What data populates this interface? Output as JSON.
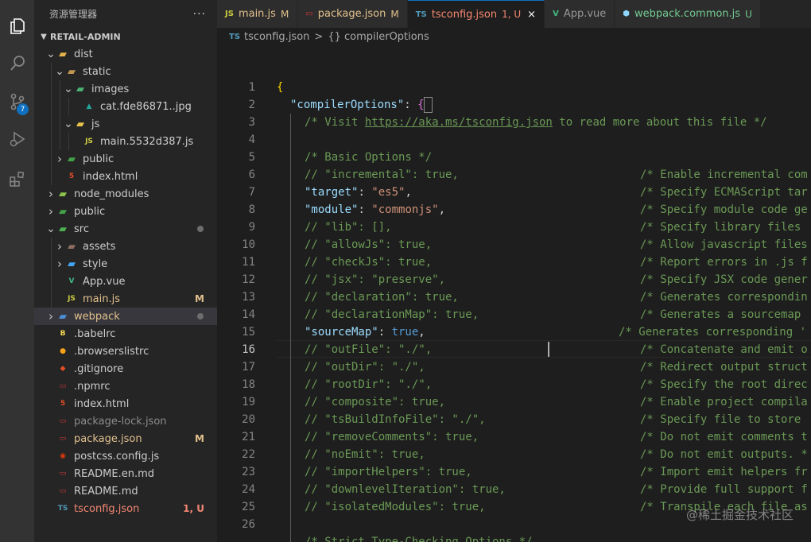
{
  "activity_bar": {
    "icons": [
      "explorer-icon",
      "search-icon",
      "source-control-icon",
      "run-debug-icon",
      "extensions-icon"
    ],
    "scm_badge": "7"
  },
  "sidebar": {
    "title": "资源管理器",
    "more": "···",
    "section": "RETAIL-ADMIN",
    "tree": [
      {
        "label": "dist",
        "type": "folder",
        "open": true,
        "depth": 0,
        "icon": "dist-folder-icon"
      },
      {
        "label": "static",
        "type": "folder",
        "open": true,
        "depth": 1,
        "icon": "folder-icon"
      },
      {
        "label": "images",
        "type": "folder",
        "open": true,
        "depth": 2,
        "icon": "images-folder-icon"
      },
      {
        "label": "cat.fde86871..jpg",
        "type": "file",
        "depth": 3,
        "icon": "image-file-icon"
      },
      {
        "label": "js",
        "type": "folder",
        "open": true,
        "depth": 2,
        "icon": "js-folder-icon"
      },
      {
        "label": "main.5532d387.js",
        "type": "file",
        "depth": 3,
        "icon": "js-file-icon"
      },
      {
        "label": "public",
        "type": "folder",
        "open": false,
        "depth": 1,
        "icon": "public-folder-icon"
      },
      {
        "label": "index.html",
        "type": "file",
        "depth": 1,
        "icon": "html-file-icon"
      },
      {
        "label": "node_modules",
        "type": "folder",
        "open": false,
        "depth": 0,
        "icon": "node-folder-icon"
      },
      {
        "label": "public",
        "type": "folder",
        "open": false,
        "depth": 0,
        "icon": "public-folder-icon"
      },
      {
        "label": "src",
        "type": "folder",
        "open": true,
        "depth": 0,
        "icon": "src-folder-icon",
        "dot": true
      },
      {
        "label": "assets",
        "type": "folder",
        "open": false,
        "depth": 1,
        "icon": "assets-folder-icon"
      },
      {
        "label": "style",
        "type": "folder",
        "open": false,
        "depth": 1,
        "icon": "style-folder-icon"
      },
      {
        "label": "App.vue",
        "type": "file",
        "depth": 1,
        "icon": "vue-file-icon"
      },
      {
        "label": "main.js",
        "type": "file",
        "depth": 1,
        "icon": "js-file-icon",
        "status": "M",
        "modified": true
      },
      {
        "label": "webpack",
        "type": "folder",
        "open": false,
        "depth": 0,
        "icon": "webpack-folder-icon",
        "dot": true,
        "selected": true
      },
      {
        "label": ".babelrc",
        "type": "file",
        "depth": 0,
        "icon": "babel-file-icon"
      },
      {
        "label": ".browserslistrc",
        "type": "file",
        "depth": 0,
        "icon": "browserslist-file-icon"
      },
      {
        "label": ".gitignore",
        "type": "file",
        "depth": 0,
        "icon": "git-file-icon"
      },
      {
        "label": ".npmrc",
        "type": "file",
        "depth": 0,
        "icon": "npm-file-icon"
      },
      {
        "label": "index.html",
        "type": "file",
        "depth": 0,
        "icon": "html-file-icon"
      },
      {
        "label": "package-lock.json",
        "type": "file",
        "depth": 0,
        "icon": "npm-file-icon",
        "ignored": true
      },
      {
        "label": "package.json",
        "type": "file",
        "depth": 0,
        "icon": "npm-file-icon",
        "status": "M",
        "modified": true
      },
      {
        "label": "postcss.config.js",
        "type": "file",
        "depth": 0,
        "icon": "postcss-file-icon"
      },
      {
        "label": "README.en.md",
        "type": "file",
        "depth": 0,
        "icon": "markdown-file-icon"
      },
      {
        "label": "README.md",
        "type": "file",
        "depth": 0,
        "icon": "markdown-file-icon"
      },
      {
        "label": "tsconfig.json",
        "type": "file",
        "depth": 0,
        "icon": "ts-file-icon",
        "status": "1, U",
        "error": true
      }
    ]
  },
  "tabs": [
    {
      "label": "main.js",
      "icon_text": "JS",
      "icon": "js-file-icon",
      "status": "M",
      "kind": "modified"
    },
    {
      "label": "package.json",
      "icon_text": "▭",
      "icon": "npm-file-icon",
      "status": "M",
      "kind": "modified"
    },
    {
      "label": "tsconfig.json",
      "icon_text": "TS",
      "icon": "ts-file-icon",
      "status": "1, U",
      "kind": "error",
      "active": true,
      "close": "×"
    },
    {
      "label": "App.vue",
      "icon_text": "V",
      "icon": "vue-file-icon",
      "status": "",
      "kind": ""
    },
    {
      "label": "webpack.common.js",
      "icon_text": "⬢",
      "icon": "webpack-file-icon",
      "status": "U",
      "kind": "untracked"
    }
  ],
  "breadcrumb": {
    "file": "tsconfig.json",
    "file_icon": "TS",
    "separator": ">",
    "symbol": "{} compilerOptions"
  },
  "code": {
    "first_line": 1,
    "current_line": 16,
    "lines": [
      {
        "n": "1",
        "html": "<span class='brace'>{</span>",
        "indent": 0
      },
      {
        "n": "2",
        "html": "<span class='key'>\"compilerOptions\"</span>: <span class='brace2'>{</span>",
        "indent": 1
      },
      {
        "n": "3",
        "html": "<span class='c'>/* Visit </span><span class='link'>https://aka.ms/tsconfig.json</span><span class='c'> to read more about this file */</span>",
        "indent": 2
      },
      {
        "n": "4",
        "html": "",
        "indent": 0
      },
      {
        "n": "5",
        "html": "<span class='c'>/* Basic Options */</span>",
        "indent": 2
      },
      {
        "n": "6",
        "html": "<span class='c'>// \"incremental\": true,</span>",
        "indent": 2,
        "comment": "/* Enable incremental com"
      },
      {
        "n": "7",
        "html": "<span class='key'>\"target\"</span>: <span class='str'>\"es5\"</span>,",
        "indent": 2,
        "comment": "/* Specify ECMAScript tar"
      },
      {
        "n": "8",
        "html": "<span class='key'>\"module\"</span>: <span class='str'>\"commonjs\"</span>,",
        "indent": 2,
        "comment": "/* Specify module code ge"
      },
      {
        "n": "9",
        "html": "<span class='c'>// \"lib\": [],</span>",
        "indent": 2,
        "comment": "/* Specify library files"
      },
      {
        "n": "10",
        "html": "<span class='c'>// \"allowJs\": true,</span>",
        "indent": 2,
        "comment": "/* Allow javascript files"
      },
      {
        "n": "11",
        "html": "<span class='c'>// \"checkJs\": true,</span>",
        "indent": 2,
        "comment": "/* Report errors in .js f"
      },
      {
        "n": "12",
        "html": "<span class='c'>// \"jsx\": \"preserve\",</span>",
        "indent": 2,
        "comment": "/* Specify JSX code gener"
      },
      {
        "n": "13",
        "html": "<span class='c'>// \"declaration\": true,</span>",
        "indent": 2,
        "comment": "/* Generates correspondin"
      },
      {
        "n": "14",
        "html": "<span class='c'>// \"declarationMap\": true,</span>",
        "indent": 2,
        "comment": "/* Generates a sourcemap"
      },
      {
        "n": "15",
        "html": "<span class='key'>\"sourceMap\"</span>: <span class='kw'>true</span>,",
        "indent": 2,
        "comment": "/* Generates corresponding '",
        "comment_shift": true
      },
      {
        "n": "16",
        "html": "<span class='c'>// \"outFile\": \"./\",</span>",
        "indent": 2,
        "comment": "/* Concatenate and emit o"
      },
      {
        "n": "17",
        "html": "<span class='c'>// \"outDir\": \"./\",</span>",
        "indent": 2,
        "comment": "/* Redirect output struct"
      },
      {
        "n": "18",
        "html": "<span class='c'>// \"rootDir\": \"./\",</span>",
        "indent": 2,
        "comment": "/* Specify the root direc"
      },
      {
        "n": "19",
        "html": "<span class='c'>// \"composite\": true,</span>",
        "indent": 2,
        "comment": "/* Enable project compila"
      },
      {
        "n": "20",
        "html": "<span class='c'>// \"tsBuildInfoFile\": \"./\",</span>",
        "indent": 2,
        "comment": "/* Specify file to store"
      },
      {
        "n": "21",
        "html": "<span class='c'>// \"removeComments\": true,</span>",
        "indent": 2,
        "comment": "/* Do not emit comments t"
      },
      {
        "n": "22",
        "html": "<span class='c'>// \"noEmit\": true,</span>",
        "indent": 2,
        "comment": "/* Do not emit outputs. *"
      },
      {
        "n": "23",
        "html": "<span class='c'>// \"importHelpers\": true,</span>",
        "indent": 2,
        "comment": "/* Import emit helpers fr"
      },
      {
        "n": "24",
        "html": "<span class='c'>// \"downlevelIteration\": true,</span>",
        "indent": 2,
        "comment": "/* Provide full support f"
      },
      {
        "n": "25",
        "html": "<span class='c'>// \"isolatedModules\": true,</span>",
        "indent": 2,
        "comment": "/* Transpile each file as"
      },
      {
        "n": "26",
        "html": "",
        "indent": 0
      },
      {
        "n": "",
        "html": "<span class='c'>/* Strict Type-Checking Options */</span>",
        "indent": 2
      }
    ]
  },
  "watermark": "@稀土掘金技术社区",
  "colors": {
    "modified": "#e2c08d",
    "error": "#f48771",
    "accent": "#0e70c0"
  }
}
